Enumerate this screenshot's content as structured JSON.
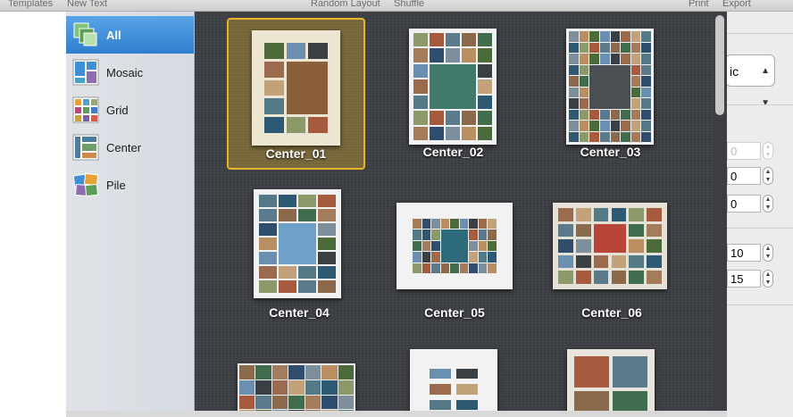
{
  "toolbar": {
    "templates": "Templates",
    "new_text": "New Text",
    "random_layout": "Random Layout",
    "shuffle": "Shuffle",
    "print": "Print",
    "export": "Export"
  },
  "categories": [
    {
      "label": "All",
      "icon": "all-layouts-icon",
      "selected": true
    },
    {
      "label": "Mosaic",
      "icon": "mosaic-icon",
      "selected": false
    },
    {
      "label": "Grid",
      "icon": "grid-icon",
      "selected": false
    },
    {
      "label": "Center",
      "icon": "center-icon",
      "selected": false
    },
    {
      "label": "Pile",
      "icon": "pile-icon",
      "selected": false
    }
  ],
  "templates": [
    {
      "name": "Center_01",
      "selected": true
    },
    {
      "name": "Center_02",
      "selected": false
    },
    {
      "name": "Center_03",
      "selected": false
    },
    {
      "name": "Center_04",
      "selected": false
    },
    {
      "name": "Center_05",
      "selected": false
    },
    {
      "name": "Center_06",
      "selected": false
    }
  ],
  "inspector": {
    "popup_value": "ic",
    "fields": [
      "0",
      "0",
      "0",
      "10",
      "15"
    ]
  },
  "colors": {
    "selection_border": "#e4b52a",
    "sidebar_selected": "#3a8ad8",
    "grid_background": "#3d4045"
  }
}
